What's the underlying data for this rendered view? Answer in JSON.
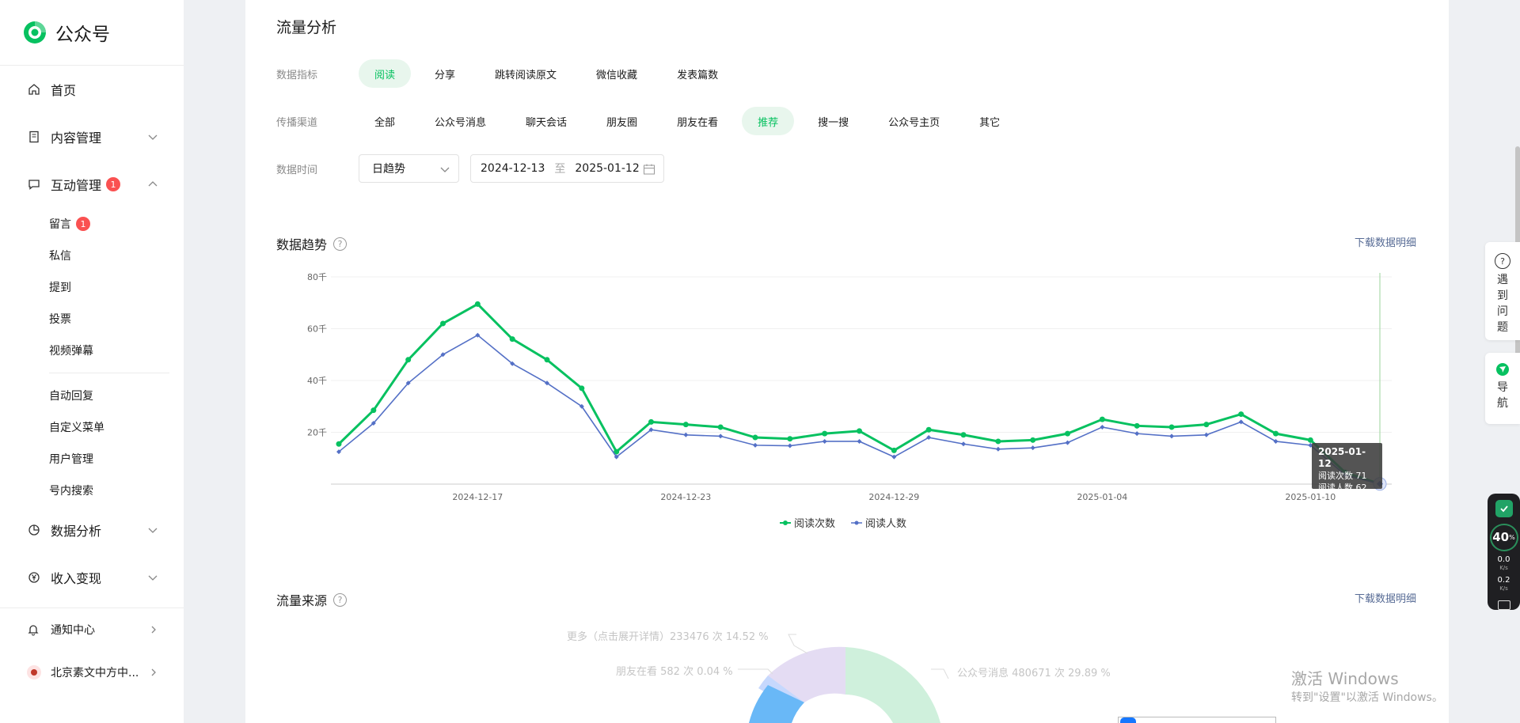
{
  "app": {
    "name": "公众号",
    "brand_color": "#07c160"
  },
  "sidebar": {
    "home": "首页",
    "content": "内容管理",
    "interaction": "互动管理",
    "interaction_badge": "1",
    "interaction_sub_a": [
      {
        "label": "留言",
        "badge": "1"
      },
      {
        "label": "私信"
      },
      {
        "label": "提到"
      },
      {
        "label": "投票"
      },
      {
        "label": "视频弹幕"
      }
    ],
    "interaction_sub_b": [
      {
        "label": "自动回复"
      },
      {
        "label": "自定义菜单"
      },
      {
        "label": "用户管理"
      },
      {
        "label": "号内搜索"
      }
    ],
    "analytics": "数据分析",
    "monetize": "收入变现",
    "notifications": "通知中心",
    "account": "北京素文中方中..."
  },
  "page": {
    "title": "流量分析",
    "metric_label": "数据指标",
    "metrics": [
      "阅读",
      "分享",
      "跳转阅读原文",
      "微信收藏",
      "发表篇数"
    ],
    "metric_active": "阅读",
    "channel_label": "传播渠道",
    "channels": [
      "全部",
      "公众号消息",
      "聊天会话",
      "朋友圈",
      "朋友在看",
      "推荐",
      "搜一搜",
      "公众号主页",
      "其它"
    ],
    "channel_active": "推荐",
    "time_label": "数据时间",
    "granularity": "日趋势",
    "date_from": "2024-12-13",
    "date_sep": "至",
    "date_to": "2025-01-12"
  },
  "trend": {
    "title": "数据趋势",
    "download": "下载数据明细",
    "tooltip": {
      "date": "2025-01-12",
      "line1": "阅读次数 71",
      "line2": "阅读人数 62"
    }
  },
  "chart_data": {
    "type": "line",
    "x": [
      "2024-12-13",
      "2024-12-14",
      "2024-12-15",
      "2024-12-16",
      "2024-12-17",
      "2024-12-18",
      "2024-12-19",
      "2024-12-20",
      "2024-12-21",
      "2024-12-22",
      "2024-12-23",
      "2024-12-24",
      "2024-12-25",
      "2024-12-26",
      "2024-12-27",
      "2024-12-28",
      "2024-12-29",
      "2024-12-30",
      "2024-12-31",
      "2025-01-01",
      "2025-01-02",
      "2025-01-03",
      "2025-01-04",
      "2025-01-05",
      "2025-01-06",
      "2025-01-07",
      "2025-01-08",
      "2025-01-09",
      "2025-01-10",
      "2025-01-11",
      "2025-01-12"
    ],
    "tick_labels": [
      "2024-12-17",
      "2024-12-23",
      "2024-12-29",
      "2025-01-04",
      "2025-01-10"
    ],
    "y_ticks": [
      "20千",
      "40千",
      "60千",
      "80千"
    ],
    "ylim": [
      0,
      80000
    ],
    "series": [
      {
        "name": "阅读次数",
        "color": "#07c160",
        "values": [
          15500,
          28500,
          48000,
          62000,
          69500,
          56000,
          48000,
          37000,
          12500,
          24000,
          23000,
          22000,
          18000,
          17500,
          19500,
          20500,
          13000,
          21000,
          19000,
          16500,
          17000,
          19500,
          25000,
          22500,
          22000,
          23000,
          27000,
          19500,
          17000,
          4500,
          71
        ]
      },
      {
        "name": "阅读人数",
        "color": "#5470c6",
        "values": [
          12500,
          23500,
          39000,
          50000,
          57500,
          46500,
          39000,
          30000,
          10500,
          21000,
          19000,
          18500,
          15000,
          14800,
          16500,
          16500,
          10500,
          18000,
          15500,
          13500,
          14000,
          16000,
          22000,
          19500,
          18500,
          19000,
          24000,
          16500,
          15000,
          3500,
          62
        ]
      }
    ],
    "legend_position": "bottom"
  },
  "source": {
    "title": "流量来源",
    "download": "下载数据明细",
    "labels": {
      "more": "更多（点击展开详情）233476 次 14.52 %",
      "friends": "朋友在看 582 次 0.04 %",
      "official": "公众号消息 480671 次 29.89 %"
    }
  },
  "float": {
    "help": [
      "遇",
      "到",
      "问",
      "题"
    ],
    "nav": [
      "导",
      "航"
    ]
  },
  "net": {
    "percent": "40",
    "percent_unit": "%",
    "up": "0.0",
    "down": "0.2",
    "unit": "K/s"
  },
  "watermark": {
    "line1": "激活 Windows",
    "line2": "转到\"设置\"以激活 Windows。"
  }
}
